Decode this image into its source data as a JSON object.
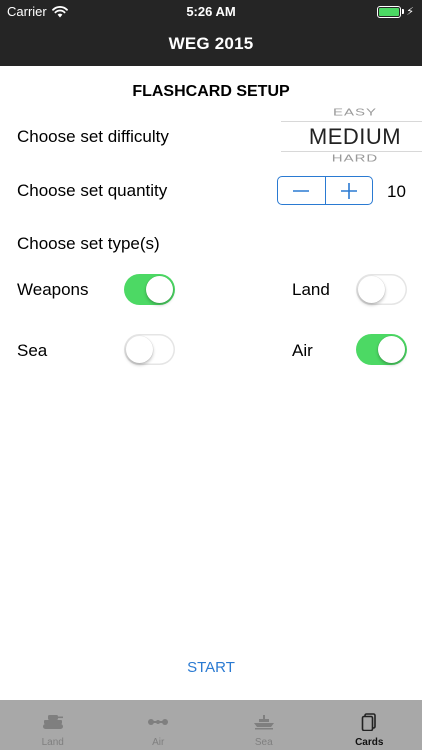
{
  "status_bar": {
    "carrier": "Carrier",
    "time": "5:26 AM"
  },
  "header": {
    "title": "WEG 2015"
  },
  "setup": {
    "title": "FLASHCARD SETUP",
    "difficulty_label": "Choose set difficulty",
    "difficulty_options": [
      "EASY",
      "MEDIUM",
      "HARD"
    ],
    "difficulty_selected": "MEDIUM",
    "quantity_label": "Choose set quantity",
    "quantity_value": "10",
    "type_label": "Choose set type(s)"
  },
  "types": [
    {
      "label": "Weapons",
      "on": true
    },
    {
      "label": "Land",
      "on": false
    },
    {
      "label": "Sea",
      "on": false
    },
    {
      "label": "Air",
      "on": true
    }
  ],
  "start_label": "START",
  "tabs": [
    {
      "label": "Land",
      "icon": "tank-icon",
      "active": false
    },
    {
      "label": "Air",
      "icon": "aircraft-icon",
      "active": false
    },
    {
      "label": "Sea",
      "icon": "ship-icon",
      "active": false
    },
    {
      "label": "Cards",
      "icon": "cards-icon",
      "active": true
    }
  ],
  "colors": {
    "accent": "#2a7ad2",
    "toggle_on": "#4cd964",
    "header_bg": "#252525",
    "tabbar_bg": "#a8a8a8"
  }
}
